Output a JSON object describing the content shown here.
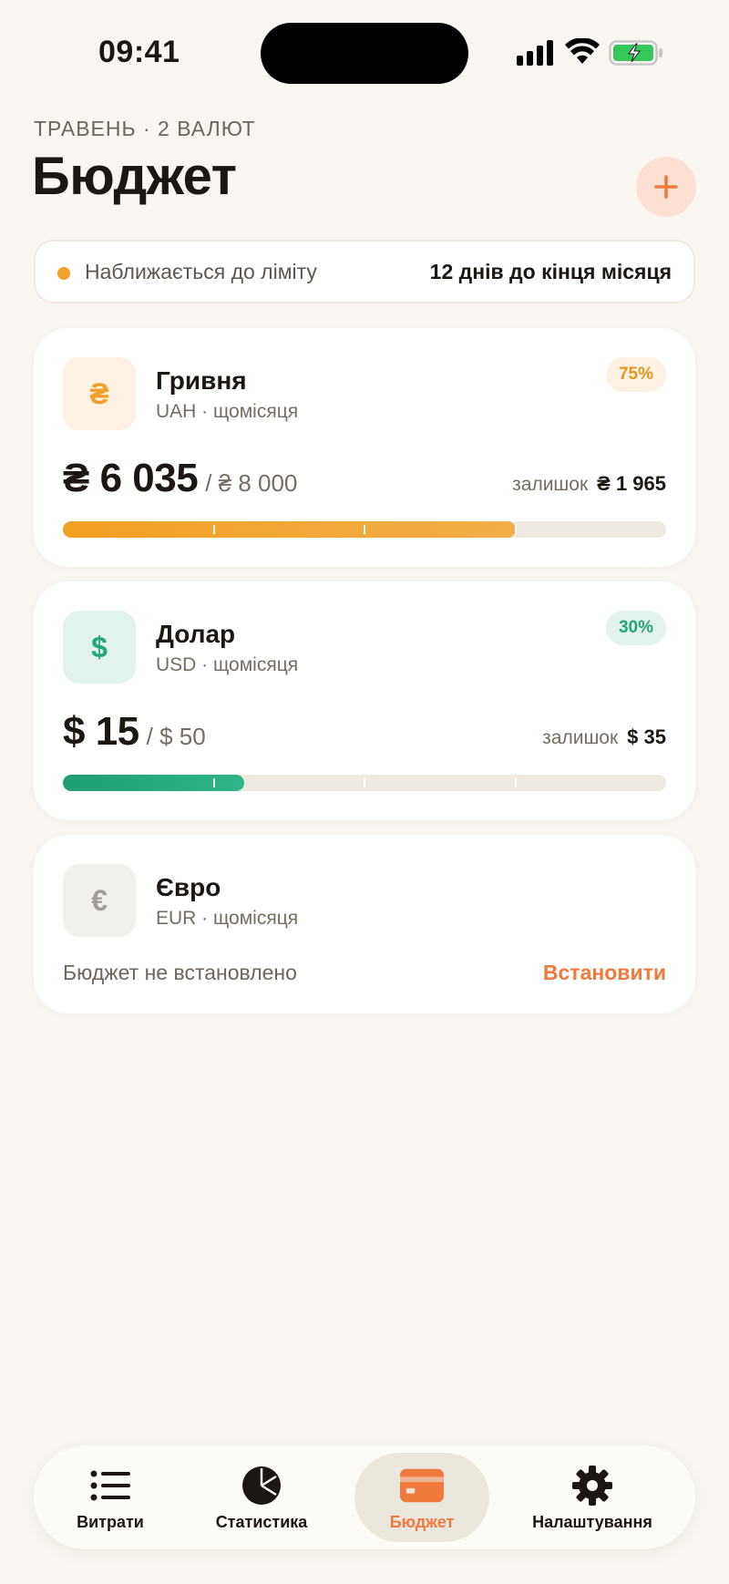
{
  "status_bar": {
    "time": "09:41"
  },
  "header": {
    "subtitle": "ТРАВЕНЬ · 2 ВАЛЮТ",
    "title": "Бюджет",
    "add_icon": "plus-icon"
  },
  "notice": {
    "text": "Наближається до ліміту",
    "days_left": "12 днів до кінця місяця",
    "dot_color": "#f2a02c"
  },
  "budgets": [
    {
      "symbol": "₴",
      "name": "Гривня",
      "period": "UAH · щомісяця",
      "percent_label": "75%",
      "spent": "₴ 6 035",
      "limit": "/ ₴ 8 000",
      "remaining_label": "залишок",
      "remaining_value": "₴ 1 965",
      "progress": 0.75,
      "color": "#f2a02c"
    },
    {
      "symbol": "$",
      "name": "Долар",
      "period": "USD · щомісяця",
      "percent_label": "30%",
      "spent": "$ 15",
      "limit": "/ $ 50",
      "remaining_label": "залишок",
      "remaining_value": "$ 35",
      "progress": 0.3,
      "color": "#24a57a"
    },
    {
      "symbol": "€",
      "name": "Євро",
      "period": "EUR · щомісяця",
      "empty_text": "Бюджет не встановлено",
      "action": "Встановити"
    }
  ],
  "tabs": [
    {
      "label": "Витрати",
      "icon": "list-icon"
    },
    {
      "label": "Статистика",
      "icon": "pie-chart-icon"
    },
    {
      "label": "Бюджет",
      "icon": "wallet-card-icon",
      "active": true
    },
    {
      "label": "Налаштування",
      "icon": "gear-icon"
    }
  ],
  "accent_color": "#f07a3e"
}
